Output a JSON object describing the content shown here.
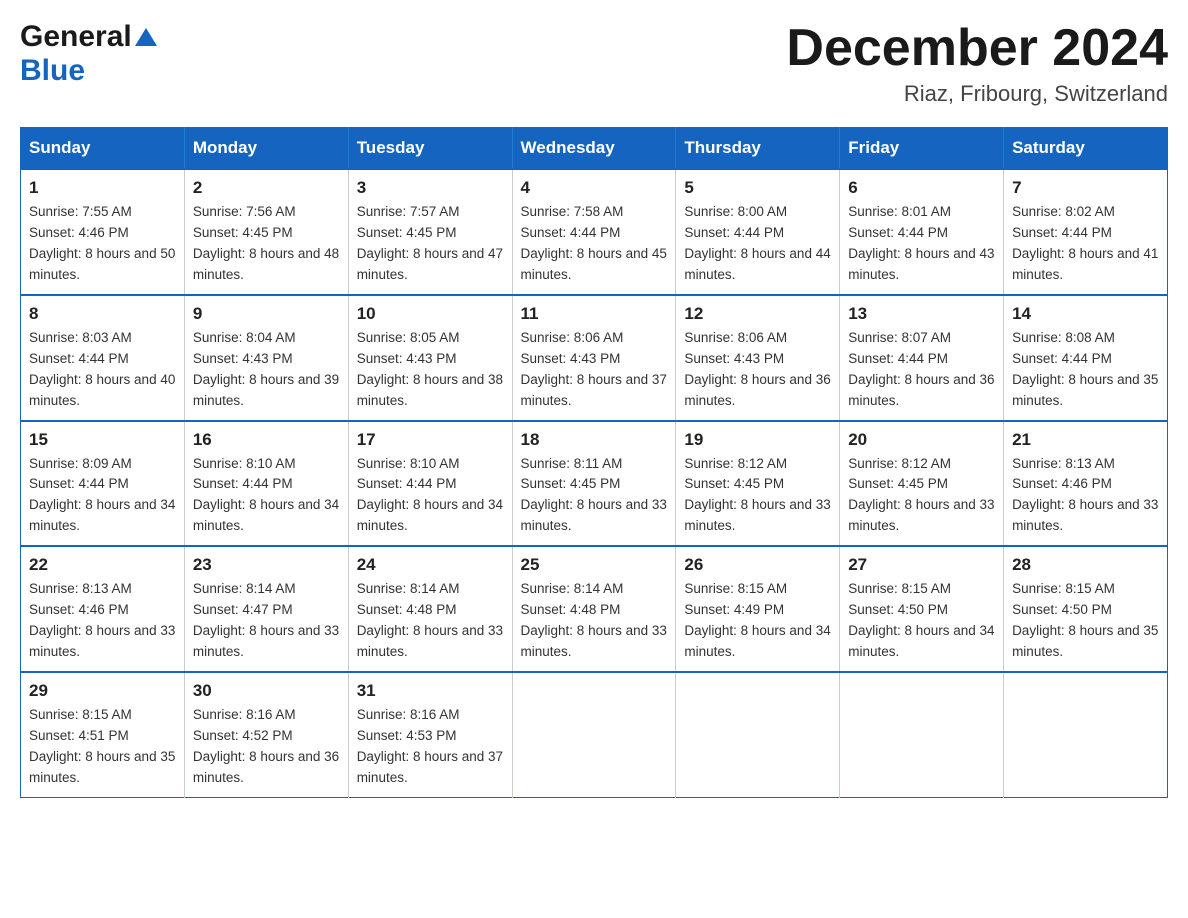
{
  "logo": {
    "general": "General",
    "blue": "Blue"
  },
  "title": "December 2024",
  "location": "Riaz, Fribourg, Switzerland",
  "days_of_week": [
    "Sunday",
    "Monday",
    "Tuesday",
    "Wednesday",
    "Thursday",
    "Friday",
    "Saturday"
  ],
  "weeks": [
    [
      {
        "day": "1",
        "sunrise": "7:55 AM",
        "sunset": "4:46 PM",
        "daylight": "8 hours and 50 minutes."
      },
      {
        "day": "2",
        "sunrise": "7:56 AM",
        "sunset": "4:45 PM",
        "daylight": "8 hours and 48 minutes."
      },
      {
        "day": "3",
        "sunrise": "7:57 AM",
        "sunset": "4:45 PM",
        "daylight": "8 hours and 47 minutes."
      },
      {
        "day": "4",
        "sunrise": "7:58 AM",
        "sunset": "4:44 PM",
        "daylight": "8 hours and 45 minutes."
      },
      {
        "day": "5",
        "sunrise": "8:00 AM",
        "sunset": "4:44 PM",
        "daylight": "8 hours and 44 minutes."
      },
      {
        "day": "6",
        "sunrise": "8:01 AM",
        "sunset": "4:44 PM",
        "daylight": "8 hours and 43 minutes."
      },
      {
        "day": "7",
        "sunrise": "8:02 AM",
        "sunset": "4:44 PM",
        "daylight": "8 hours and 41 minutes."
      }
    ],
    [
      {
        "day": "8",
        "sunrise": "8:03 AM",
        "sunset": "4:44 PM",
        "daylight": "8 hours and 40 minutes."
      },
      {
        "day": "9",
        "sunrise": "8:04 AM",
        "sunset": "4:43 PM",
        "daylight": "8 hours and 39 minutes."
      },
      {
        "day": "10",
        "sunrise": "8:05 AM",
        "sunset": "4:43 PM",
        "daylight": "8 hours and 38 minutes."
      },
      {
        "day": "11",
        "sunrise": "8:06 AM",
        "sunset": "4:43 PM",
        "daylight": "8 hours and 37 minutes."
      },
      {
        "day": "12",
        "sunrise": "8:06 AM",
        "sunset": "4:43 PM",
        "daylight": "8 hours and 36 minutes."
      },
      {
        "day": "13",
        "sunrise": "8:07 AM",
        "sunset": "4:44 PM",
        "daylight": "8 hours and 36 minutes."
      },
      {
        "day": "14",
        "sunrise": "8:08 AM",
        "sunset": "4:44 PM",
        "daylight": "8 hours and 35 minutes."
      }
    ],
    [
      {
        "day": "15",
        "sunrise": "8:09 AM",
        "sunset": "4:44 PM",
        "daylight": "8 hours and 34 minutes."
      },
      {
        "day": "16",
        "sunrise": "8:10 AM",
        "sunset": "4:44 PM",
        "daylight": "8 hours and 34 minutes."
      },
      {
        "day": "17",
        "sunrise": "8:10 AM",
        "sunset": "4:44 PM",
        "daylight": "8 hours and 34 minutes."
      },
      {
        "day": "18",
        "sunrise": "8:11 AM",
        "sunset": "4:45 PM",
        "daylight": "8 hours and 33 minutes."
      },
      {
        "day": "19",
        "sunrise": "8:12 AM",
        "sunset": "4:45 PM",
        "daylight": "8 hours and 33 minutes."
      },
      {
        "day": "20",
        "sunrise": "8:12 AM",
        "sunset": "4:45 PM",
        "daylight": "8 hours and 33 minutes."
      },
      {
        "day": "21",
        "sunrise": "8:13 AM",
        "sunset": "4:46 PM",
        "daylight": "8 hours and 33 minutes."
      }
    ],
    [
      {
        "day": "22",
        "sunrise": "8:13 AM",
        "sunset": "4:46 PM",
        "daylight": "8 hours and 33 minutes."
      },
      {
        "day": "23",
        "sunrise": "8:14 AM",
        "sunset": "4:47 PM",
        "daylight": "8 hours and 33 minutes."
      },
      {
        "day": "24",
        "sunrise": "8:14 AM",
        "sunset": "4:48 PM",
        "daylight": "8 hours and 33 minutes."
      },
      {
        "day": "25",
        "sunrise": "8:14 AM",
        "sunset": "4:48 PM",
        "daylight": "8 hours and 33 minutes."
      },
      {
        "day": "26",
        "sunrise": "8:15 AM",
        "sunset": "4:49 PM",
        "daylight": "8 hours and 34 minutes."
      },
      {
        "day": "27",
        "sunrise": "8:15 AM",
        "sunset": "4:50 PM",
        "daylight": "8 hours and 34 minutes."
      },
      {
        "day": "28",
        "sunrise": "8:15 AM",
        "sunset": "4:50 PM",
        "daylight": "8 hours and 35 minutes."
      }
    ],
    [
      {
        "day": "29",
        "sunrise": "8:15 AM",
        "sunset": "4:51 PM",
        "daylight": "8 hours and 35 minutes."
      },
      {
        "day": "30",
        "sunrise": "8:16 AM",
        "sunset": "4:52 PM",
        "daylight": "8 hours and 36 minutes."
      },
      {
        "day": "31",
        "sunrise": "8:16 AM",
        "sunset": "4:53 PM",
        "daylight": "8 hours and 37 minutes."
      },
      null,
      null,
      null,
      null
    ]
  ]
}
